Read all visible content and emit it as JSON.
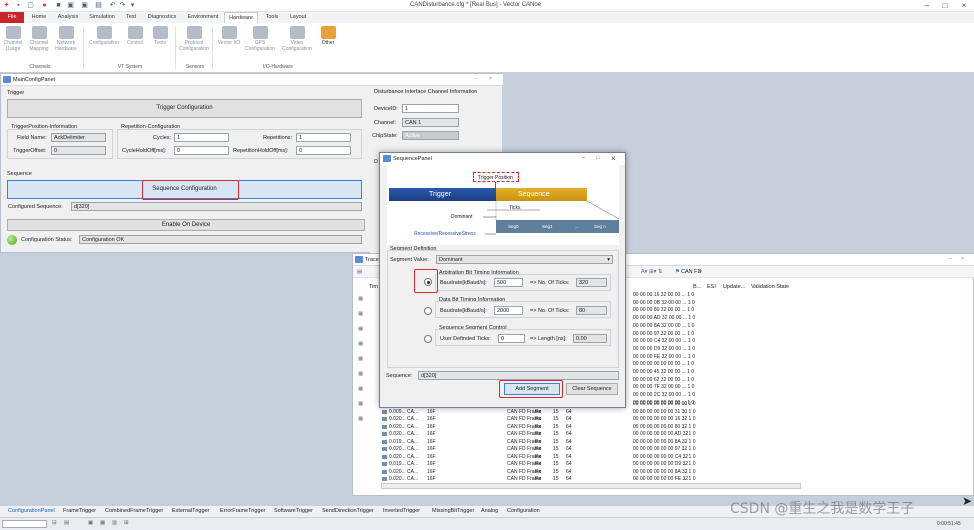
{
  "app": {
    "title": "CANDisturbance.cfg * [Real Bus] - Vector CANoe",
    "watermark": "CSDN @重生之我是数学王子",
    "clock": "0:00:51:45"
  },
  "ribbon_tabs": [
    "File",
    "Home",
    "Analysis",
    "Simulation",
    "Test",
    "Diagnostics",
    "Environment",
    "Hardware",
    "Tools",
    "Layout"
  ],
  "ribbon_buttons": {
    "channel_usage": "Channel Usage",
    "channel_mapping": "Channel Mapping",
    "network_hardware": "Network Hardware",
    "configuration": "Configuration",
    "control": "Control",
    "tools": "Tools",
    "protocol_configuration": "Protocol Configuration",
    "vector_io": "Vector I/O",
    "gps_configuration": "GPS Configuration",
    "video_configuration": "Video Configuration",
    "other": "Other"
  },
  "ribbon_groups": {
    "channels": "Channels",
    "vt_system": "VT System",
    "sensors": "Sensors",
    "io_hardware": "I/O-Hardware"
  },
  "main_panel": {
    "title": "MainConfigPanel",
    "trigger_section": "Trigger",
    "trigger_config_button": "Trigger Configuration",
    "trigger_position_group": "TriggerPosition-Information",
    "field_name_label": "Field Name:",
    "field_name_value": "AckDelimiter",
    "trigger_offset_label": "TriggerOffset:",
    "trigger_offset_value": "0",
    "repetition_group": "Repetition-Configuration",
    "cycles_label": "Cycles:",
    "cycles_value": "1",
    "repetitions_label": "Repetitions:",
    "repetitions_value": "1",
    "cycle_holdoff_label": "CycleHoldOff[ms]:",
    "cycle_holdoff_value": "0",
    "rep_holdoff_label": "RepetitionHoldOff[ms]:",
    "rep_holdoff_value": "0",
    "sequence_section": "Sequence",
    "sequence_config_button": "Sequence Configuration",
    "configured_sequence_label": "Configured Sequence:",
    "configured_sequence_value": "d[320]",
    "enable_button": "Enable On Device",
    "config_status_label": "Configuration Status:",
    "config_status_value": "Configuration OK"
  },
  "disturbance_info": {
    "title": "Disturbance Interface Channel Information",
    "device_id_label": "DeviceID:",
    "device_id_value": "1",
    "channel_label": "Channel:",
    "channel_value": "CAN 1",
    "chip_state_label": "ChipState:",
    "chip_state_value": "Active",
    "truncated_d": "D"
  },
  "trace": {
    "title": "Trace",
    "can_fd_filter": "CAN FD",
    "col_time": "Tim",
    "col_b": "B...",
    "col_esi": "ESI",
    "col_update": "Update...",
    "col_validation": "Validation State",
    "rows": [
      [
        "0.010...",
        "CA...",
        "30A",
        "CAN FD Frame",
        "Rx",
        "15",
        "64",
        "00 00 00 00 00 00 00 00"
      ],
      [
        "0.009...",
        "CA...",
        "16F",
        "CAN FD Frame",
        "Rx",
        "15",
        "64",
        "00 80 00 00 00 00 31 30"
      ],
      [
        "0.020...",
        "CA...",
        "16F",
        "CAN FD Frame",
        "Rx",
        "15",
        "64",
        "00 00 00 00 00 00 16 32"
      ],
      [
        "0.020...",
        "CA...",
        "16F",
        "CAN FD Frame",
        "Rx",
        "15",
        "64",
        "00 00 00 00 00 00 80 32"
      ],
      [
        "0.020...",
        "CA...",
        "16F",
        "CAN FD Frame",
        "Rx",
        "15",
        "64",
        "00 00 00 00 00 00 AD 32"
      ],
      [
        "0.019...",
        "CA...",
        "16F",
        "CAN FD Frame",
        "Rx",
        "15",
        "64",
        "00 00 00 00 00 00 8A 32"
      ],
      [
        "0.020...",
        "CA...",
        "16F",
        "CAN FD Frame",
        "Rx",
        "15",
        "64",
        "00 00 00 00 00 00 97 32"
      ],
      [
        "0.020...",
        "CA...",
        "16F",
        "CAN FD Frame",
        "Rx",
        "15",
        "64",
        "00 00 00 00 00 00 C4 32"
      ],
      [
        "0.019...",
        "CA...",
        "16F",
        "CAN FD Frame",
        "Rx",
        "15",
        "64",
        "00 00 00 00 00 00 D9 32"
      ],
      [
        "0.020...",
        "CA...",
        "16F",
        "CAN FD Frame",
        "Rx",
        "15",
        "64",
        "00 00 00 00 00 00 8A 32"
      ],
      [
        "0.020...",
        "CA...",
        "16F",
        "CAN FD Frame",
        "Rx",
        "15",
        "64",
        "00 00 00 00 00 00 FE 32"
      ],
      [
        "0.010...",
        "CA...",
        "30A",
        "CAN FD Frame",
        "Rx",
        "15",
        "64",
        "00 00 00 00 00 00 00 00"
      ]
    ],
    "upper_hex": [
      "00 00 00 16 32 00 00 ... 1 0",
      "00 00 00 0B 32 00 00 ... 1 0",
      "00 00 00 80 32 00 00 ... 1 0",
      "00 00 00 AD 32 00 00 ... 1 0",
      "00 00 00 8A 32 00 00 ... 1 0",
      "00 00 00 97 32 00 00 ... 1 0",
      "00 00 00 C4 32 00 00 ... 1 0",
      "00 00 00 D9 32 00 00 ... 1 0",
      "00 00 00 FE 32 00 00 ... 1 0",
      "00 00 00 00 00 00 00 ... 1 0",
      "00 00 00 45 32 00 00 ... 1 0",
      "00 00 00 62 32 00 00 ... 1 0",
      "00 00 00 7F 32 00 00 ... 1 0",
      "00 00 00 2C 32 00 00 ... 1 0",
      "00 00 00 00 00 00 00 ... 1 0"
    ],
    "row_tail": "... 1 0"
  },
  "sequence_panel": {
    "title": "SequencePanel",
    "trigger_position": "Trigger Position",
    "trigger_bar": "Trigger",
    "sequence_bar": "Sequence",
    "ticks": "Ticks",
    "dominant": "Dominant",
    "recessive": "Recessive/RecessiveStress",
    "seg0": "Seg0",
    "seg1": "Seg1",
    "seg_dots": "...",
    "segn": "Seg n",
    "segment_definition": "Segment Definition",
    "segment_value_label": "Segment Value:",
    "segment_value": "Dominant",
    "arb_group": "Arbitration Bit Timing Information",
    "arb_baud_label": "Baudrate[kBaud/s]:",
    "arb_baud_value": "500",
    "arb_ticks_label": "=> No. Of Ticks:",
    "arb_ticks_value": "320",
    "data_group": "Data Bit Timing Information",
    "data_baud_label": "Baudrate[kBaud/s]:",
    "data_baud_value": "2000",
    "data_ticks_label": "=> No. Of Ticks:",
    "data_ticks_value": "80",
    "ctrl_group": "Sequence Segment Control",
    "user_ticks_label": "User Definded Ticks:",
    "user_ticks_value": "0",
    "length_label": "=> Length [ns]:",
    "length_value": "0.00",
    "sequence_label": "Sequence:",
    "sequence_value": "d[320]",
    "add_segment": "Add Segment",
    "clear_sequence": "Clear Sequence"
  },
  "bottom_tabs": [
    "ConfigurationPanel",
    "FrameTrigger",
    "CombinedFrameTrigger",
    "ExternalTrigger",
    "ErrorFrameTrigger",
    "SoftwareTrigger",
    "SendDirectionTrigger",
    "InvertedTrigger",
    "MissingBitTrigger",
    "Analog",
    "Configuration"
  ],
  "colors": {
    "trigger_bar": "#234d9a",
    "sequence_bar": "#d7a11c",
    "highlight": "#d42a2a",
    "file_tab": "#c8262b"
  }
}
